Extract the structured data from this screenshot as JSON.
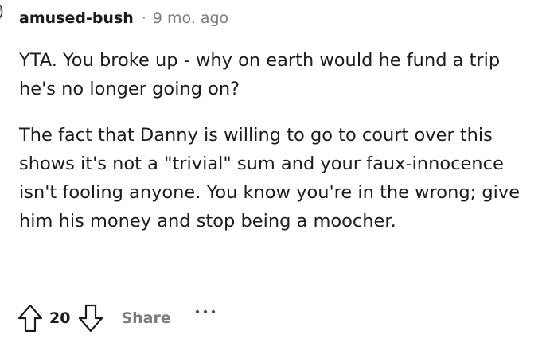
{
  "comment": {
    "author": "amused-bush",
    "separator": "·",
    "age": "9 mo. ago",
    "paragraphs": [
      "YTA. You broke up - why on earth would he fund a trip he's no longer going on?",
      "The fact that Danny is willing to go to court over this shows it's not a \"trivial\" sum and your faux-innocence isn't fooling anyone. You know you're in the wrong; give him his money and stop being a moocher."
    ],
    "score": "20"
  },
  "actions": {
    "share_label": "Share"
  },
  "icons": {
    "upvote": "upvote-arrow-icon",
    "downvote": "downvote-arrow-icon",
    "more": "more-options-icon"
  }
}
